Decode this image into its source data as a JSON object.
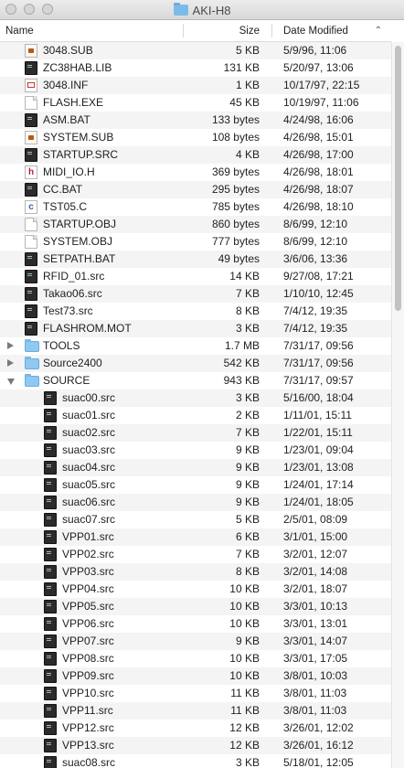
{
  "window": {
    "title": "AKI-H8"
  },
  "columns": {
    "name": "Name",
    "size": "Size",
    "date": "Date Modified"
  },
  "rows": [
    {
      "name": "3048.SUB",
      "size": "5 KB",
      "date": "5/9/96, 11:06",
      "icon": "sub-file-icon",
      "kind": "sub",
      "indent": 0
    },
    {
      "name": "ZC38HAB.LIB",
      "size": "131 KB",
      "date": "5/20/97, 13:06",
      "icon": "exec-file-icon",
      "kind": "exec",
      "indent": 0
    },
    {
      "name": "3048.INF",
      "size": "1 KB",
      "date": "10/17/97, 22:15",
      "icon": "inf-file-icon",
      "kind": "inf",
      "indent": 0
    },
    {
      "name": "FLASH.EXE",
      "size": "45 KB",
      "date": "10/19/97, 11:06",
      "icon": "document-icon",
      "kind": "doc",
      "indent": 0
    },
    {
      "name": "ASM.BAT",
      "size": "133 bytes",
      "date": "4/24/98, 16:06",
      "icon": "exec-file-icon",
      "kind": "exec",
      "indent": 0
    },
    {
      "name": "SYSTEM.SUB",
      "size": "108 bytes",
      "date": "4/26/98, 15:01",
      "icon": "sub-file-icon",
      "kind": "sub",
      "indent": 0
    },
    {
      "name": "STARTUP.SRC",
      "size": "4 KB",
      "date": "4/26/98, 17:00",
      "icon": "exec-file-icon",
      "kind": "exec",
      "indent": 0
    },
    {
      "name": "MIDI_IO.H",
      "size": "369 bytes",
      "date": "4/26/98, 18:01",
      "icon": "h-file-icon",
      "kind": "h",
      "indent": 0
    },
    {
      "name": "CC.BAT",
      "size": "295 bytes",
      "date": "4/26/98, 18:07",
      "icon": "exec-file-icon",
      "kind": "exec",
      "indent": 0
    },
    {
      "name": "TST05.C",
      "size": "785 bytes",
      "date": "4/26/98, 18:10",
      "icon": "c-file-icon",
      "kind": "c",
      "indent": 0
    },
    {
      "name": "STARTUP.OBJ",
      "size": "860 bytes",
      "date": "8/6/99, 12:10",
      "icon": "document-icon",
      "kind": "doc",
      "indent": 0
    },
    {
      "name": "SYSTEM.OBJ",
      "size": "777 bytes",
      "date": "8/6/99, 12:10",
      "icon": "document-icon",
      "kind": "doc",
      "indent": 0
    },
    {
      "name": "SETPATH.BAT",
      "size": "49 bytes",
      "date": "3/6/06, 13:36",
      "icon": "exec-file-icon",
      "kind": "exec",
      "indent": 0
    },
    {
      "name": "RFID_01.src",
      "size": "14 KB",
      "date": "9/27/08, 17:21",
      "icon": "exec-file-icon",
      "kind": "exec",
      "indent": 0
    },
    {
      "name": "Takao06.src",
      "size": "7 KB",
      "date": "1/10/10, 12:45",
      "icon": "exec-file-icon",
      "kind": "exec",
      "indent": 0
    },
    {
      "name": "Test73.src",
      "size": "8 KB",
      "date": "7/4/12, 19:35",
      "icon": "exec-file-icon",
      "kind": "exec",
      "indent": 0
    },
    {
      "name": "FLASHROM.MOT",
      "size": "3 KB",
      "date": "7/4/12, 19:35",
      "icon": "exec-file-icon",
      "kind": "exec",
      "indent": 0
    },
    {
      "name": "TOOLS",
      "size": "1.7 MB",
      "date": "7/31/17, 09:56",
      "icon": "folder-icon",
      "kind": "folder",
      "indent": 0,
      "disclosure": "closed"
    },
    {
      "name": "Source2400",
      "size": "542 KB",
      "date": "7/31/17, 09:56",
      "icon": "folder-icon",
      "kind": "folder",
      "indent": 0,
      "disclosure": "closed"
    },
    {
      "name": "SOURCE",
      "size": "943 KB",
      "date": "7/31/17, 09:57",
      "icon": "folder-icon",
      "kind": "folder",
      "indent": 0,
      "disclosure": "open"
    },
    {
      "name": "suac00.src",
      "size": "3 KB",
      "date": "5/16/00, 18:04",
      "icon": "exec-file-icon",
      "kind": "exec",
      "indent": 1
    },
    {
      "name": "suac01.src",
      "size": "2 KB",
      "date": "1/11/01, 15:11",
      "icon": "exec-file-icon",
      "kind": "exec",
      "indent": 1
    },
    {
      "name": "suac02.src",
      "size": "7 KB",
      "date": "1/22/01, 15:11",
      "icon": "exec-file-icon",
      "kind": "exec",
      "indent": 1
    },
    {
      "name": "suac03.src",
      "size": "9 KB",
      "date": "1/23/01, 09:04",
      "icon": "exec-file-icon",
      "kind": "exec",
      "indent": 1
    },
    {
      "name": "suac04.src",
      "size": "9 KB",
      "date": "1/23/01, 13:08",
      "icon": "exec-file-icon",
      "kind": "exec",
      "indent": 1
    },
    {
      "name": "suac05.src",
      "size": "9 KB",
      "date": "1/24/01, 17:14",
      "icon": "exec-file-icon",
      "kind": "exec",
      "indent": 1
    },
    {
      "name": "suac06.src",
      "size": "9 KB",
      "date": "1/24/01, 18:05",
      "icon": "exec-file-icon",
      "kind": "exec",
      "indent": 1
    },
    {
      "name": "suac07.src",
      "size": "5 KB",
      "date": "2/5/01, 08:09",
      "icon": "exec-file-icon",
      "kind": "exec",
      "indent": 1
    },
    {
      "name": "VPP01.src",
      "size": "6 KB",
      "date": "3/1/01, 15:00",
      "icon": "exec-file-icon",
      "kind": "exec",
      "indent": 1
    },
    {
      "name": "VPP02.src",
      "size": "7 KB",
      "date": "3/2/01, 12:07",
      "icon": "exec-file-icon",
      "kind": "exec",
      "indent": 1
    },
    {
      "name": "VPP03.src",
      "size": "8 KB",
      "date": "3/2/01, 14:08",
      "icon": "exec-file-icon",
      "kind": "exec",
      "indent": 1
    },
    {
      "name": "VPP04.src",
      "size": "10 KB",
      "date": "3/2/01, 18:07",
      "icon": "exec-file-icon",
      "kind": "exec",
      "indent": 1
    },
    {
      "name": "VPP05.src",
      "size": "10 KB",
      "date": "3/3/01, 10:13",
      "icon": "exec-file-icon",
      "kind": "exec",
      "indent": 1
    },
    {
      "name": "VPP06.src",
      "size": "10 KB",
      "date": "3/3/01, 13:01",
      "icon": "exec-file-icon",
      "kind": "exec",
      "indent": 1
    },
    {
      "name": "VPP07.src",
      "size": "9 KB",
      "date": "3/3/01, 14:07",
      "icon": "exec-file-icon",
      "kind": "exec",
      "indent": 1
    },
    {
      "name": "VPP08.src",
      "size": "10 KB",
      "date": "3/3/01, 17:05",
      "icon": "exec-file-icon",
      "kind": "exec",
      "indent": 1
    },
    {
      "name": "VPP09.src",
      "size": "10 KB",
      "date": "3/8/01, 10:03",
      "icon": "exec-file-icon",
      "kind": "exec",
      "indent": 1
    },
    {
      "name": "VPP10.src",
      "size": "11 KB",
      "date": "3/8/01, 11:03",
      "icon": "exec-file-icon",
      "kind": "exec",
      "indent": 1
    },
    {
      "name": "VPP11.src",
      "size": "11 KB",
      "date": "3/8/01, 11:03",
      "icon": "exec-file-icon",
      "kind": "exec",
      "indent": 1
    },
    {
      "name": "VPP12.src",
      "size": "12 KB",
      "date": "3/26/01, 12:02",
      "icon": "exec-file-icon",
      "kind": "exec",
      "indent": 1
    },
    {
      "name": "VPP13.src",
      "size": "12 KB",
      "date": "3/26/01, 16:12",
      "icon": "exec-file-icon",
      "kind": "exec",
      "indent": 1
    },
    {
      "name": "suac08.src",
      "size": "3 KB",
      "date": "5/18/01, 12:05",
      "icon": "exec-file-icon",
      "kind": "exec",
      "indent": 1
    }
  ],
  "sort": {
    "column": "Date Modified",
    "direction": "ascending"
  }
}
